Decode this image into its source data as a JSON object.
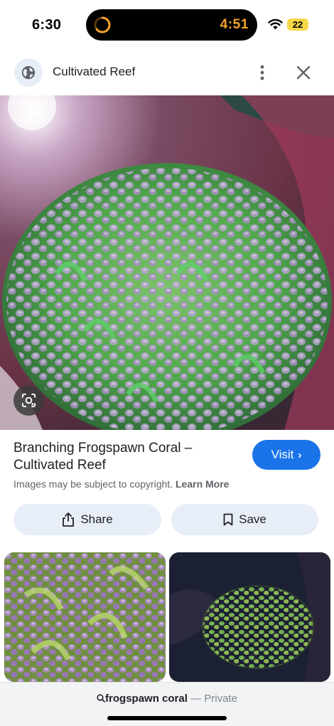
{
  "status_bar": {
    "time": "6:30",
    "timer": "4:51",
    "battery": "22",
    "icons": [
      "timer-ring-icon",
      "wifi-icon",
      "battery-icon"
    ]
  },
  "header": {
    "site_name": "Cultivated Reef",
    "icons": [
      "globe-icon",
      "more-vert-icon",
      "close-icon"
    ]
  },
  "image": {
    "description_icons": [
      "google-lens-icon"
    ]
  },
  "result": {
    "title": "Branching Frogspawn Coral – Cultivated Reef",
    "visit_label": "Visit",
    "copyright_text": "Images may be subject to copyright.",
    "learn_more": "Learn More"
  },
  "actions": {
    "share_label": "Share",
    "save_label": "Save"
  },
  "search": {
    "query": "frogspawn coral",
    "separator": "—",
    "mode": "Private"
  },
  "colors": {
    "accent": "#1a73e8",
    "pill_bg": "#e8eef8",
    "timer": "#f4a228",
    "battery": "#f5d94a"
  }
}
